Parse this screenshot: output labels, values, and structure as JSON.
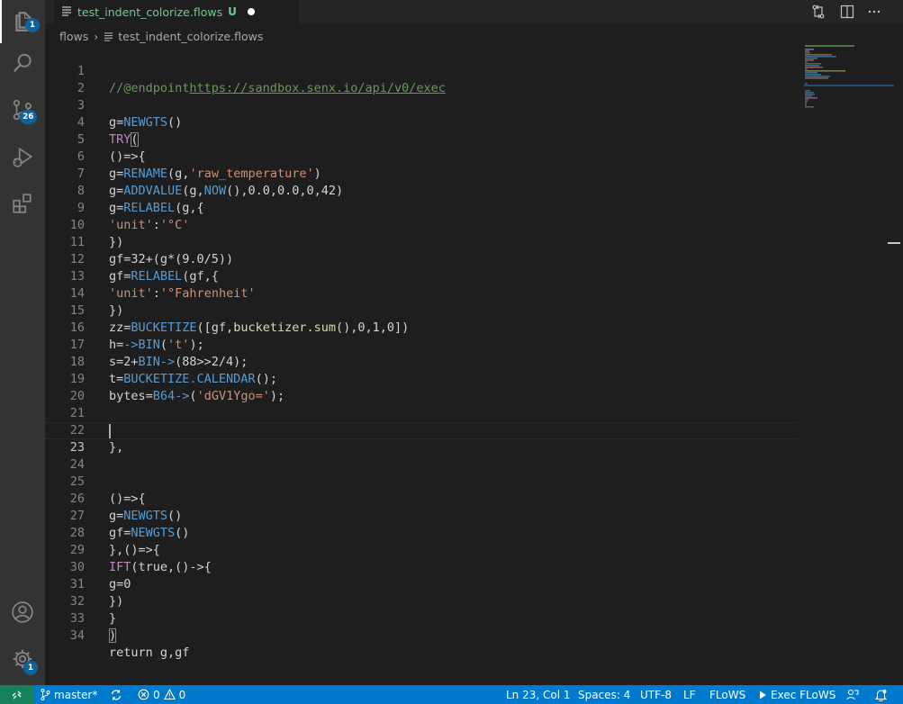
{
  "activity_bar": {
    "explorer_badge": "1",
    "source_control_badge": "26",
    "settings_badge": "1"
  },
  "tab": {
    "filename": "test_indent_colorize.flows",
    "status": "U"
  },
  "breadcrumb": {
    "folder": "flows",
    "separator": "›",
    "file": "test_indent_colorize.flows"
  },
  "editor": {
    "current_line": "23",
    "lines": [
      {
        "n": "1"
      },
      {
        "n": "2"
      },
      {
        "n": "3"
      },
      {
        "n": "4"
      },
      {
        "n": "5"
      },
      {
        "n": "6"
      },
      {
        "n": "7"
      },
      {
        "n": "8"
      },
      {
        "n": "9"
      },
      {
        "n": "10"
      },
      {
        "n": "11"
      },
      {
        "n": "12"
      },
      {
        "n": "13"
      },
      {
        "n": "14"
      },
      {
        "n": "15"
      },
      {
        "n": "16"
      },
      {
        "n": "17"
      },
      {
        "n": "18"
      },
      {
        "n": "19"
      },
      {
        "n": "20"
      },
      {
        "n": "21"
      },
      {
        "n": "22"
      },
      {
        "n": "23"
      },
      {
        "n": "24"
      },
      {
        "n": "25"
      },
      {
        "n": "26"
      },
      {
        "n": "27"
      },
      {
        "n": "28"
      },
      {
        "n": "29"
      },
      {
        "n": "30"
      },
      {
        "n": "31"
      },
      {
        "n": "32"
      },
      {
        "n": "33"
      },
      {
        "n": "34"
      }
    ],
    "code": {
      "l1a": "//@endpoint",
      "l1b": "https://sandbox.senx.io/api/v0/exec",
      "l3a": "g=",
      "l3b": "NEWGTS",
      "l3c": "()",
      "l4a": "TRY",
      "l4b": "(",
      "l5": "()=>{",
      "l6a": "g=",
      "l6b": "RENAME",
      "l6c": "(g,",
      "l6d": "'raw_temperature'",
      "l6e": ")",
      "l7a": "g=",
      "l7b": "ADDVALUE",
      "l7c": "(g,",
      "l7d": "NOW",
      "l7e": "(),0.0,0.0,0,42)",
      "l8a": "g=",
      "l8b": "RELABEL",
      "l8c": "(g,{",
      "l9a": "'unit'",
      "l9b": ":",
      "l9c": "'°C'",
      "l10": "})",
      "l11": "gf=32+(g*(9.0/5))",
      "l12a": "gf=",
      "l12b": "RELABEL",
      "l12c": "(gf,{",
      "l13a": "'unit'",
      "l13b": ":",
      "l13c": "'°Fahrenheit'",
      "l14": "})",
      "l15a": "zz=",
      "l15b": "BUCKETIZE",
      "l15c": "([gf,",
      "l15d": "bucketizer.sum",
      "l15e": "(),0,1,0])",
      "l16a": "h=",
      "l16b": "->BIN",
      "l16c": "(",
      "l16d": "'t'",
      "l16e": ");",
      "l17a": "s=2+",
      "l17b": "BIN->",
      "l17c": "(88>>2/4);",
      "l18a": "t=",
      "l18b": "BUCKETIZE.CALENDAR",
      "l18c": "();",
      "l19a": "bytes=",
      "l19b": "B64->",
      "l19c": "(",
      "l19d": "'dGV1Ygo='",
      "l19e": ");",
      "l22": "},",
      "l25": "()=>{",
      "l26a": "g=",
      "l26b": "NEWGTS",
      "l26c": "()",
      "l27a": "gf=",
      "l27b": "NEWGTS",
      "l27c": "()",
      "l28": "},()=>{",
      "l29a": "IFT",
      "l29b": "(true,()->{",
      "l30": "g=0",
      "l31": "})",
      "l32": "}",
      "l33": ")",
      "l34": "return g,gf"
    }
  },
  "status_bar": {
    "branch": "master*",
    "errors": "0",
    "warnings": "0",
    "position": "Ln 23, Col 1",
    "spaces": "Spaces: 4",
    "encoding": "UTF-8",
    "eol": "LF",
    "language": "FLoWS",
    "exec": "Exec FLoWS"
  },
  "colors": {
    "activity_bar": "#333333",
    "editor_bg": "#1e1e1e",
    "status_bar": "#007acc",
    "remote": "#16825d",
    "badge": "#0e639c",
    "untracked": "#73c991"
  }
}
